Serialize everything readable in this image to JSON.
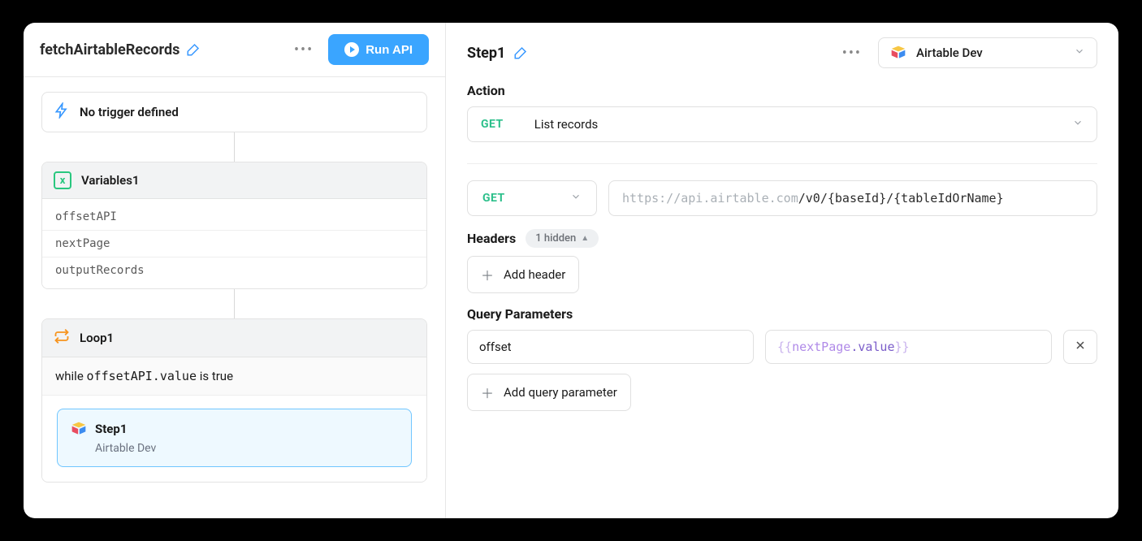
{
  "left": {
    "workflow_name": "fetchAirtableRecords",
    "run_button": "Run API",
    "trigger_text": "No trigger defined",
    "variables": {
      "title": "Variables1",
      "items": [
        "offsetAPI",
        "nextPage",
        "outputRecords"
      ]
    },
    "loop": {
      "title": "Loop1",
      "condition_prefix": "while ",
      "condition_code": "offsetAPI.value",
      "condition_suffix": " is true",
      "step": {
        "name": "Step1",
        "resource": "Airtable Dev"
      }
    }
  },
  "right": {
    "step_title": "Step1",
    "resource": "Airtable Dev",
    "action": {
      "label": "Action",
      "method": "GET",
      "name": "List records"
    },
    "request": {
      "method": "GET",
      "url_base": "https://api.airtable.com",
      "url_path": "/v0/{baseId}/{tableIdOrName}"
    },
    "headers": {
      "label": "Headers",
      "hidden_badge": "1 hidden",
      "add_label": "Add header"
    },
    "query": {
      "label": "Query Parameters",
      "rows": [
        {
          "key": "offset",
          "brace_open": "{{",
          "obj": "nextPage",
          "dot": ".",
          "prop": "value",
          "brace_close": "}}"
        }
      ],
      "add_label": "Add query parameter"
    }
  }
}
